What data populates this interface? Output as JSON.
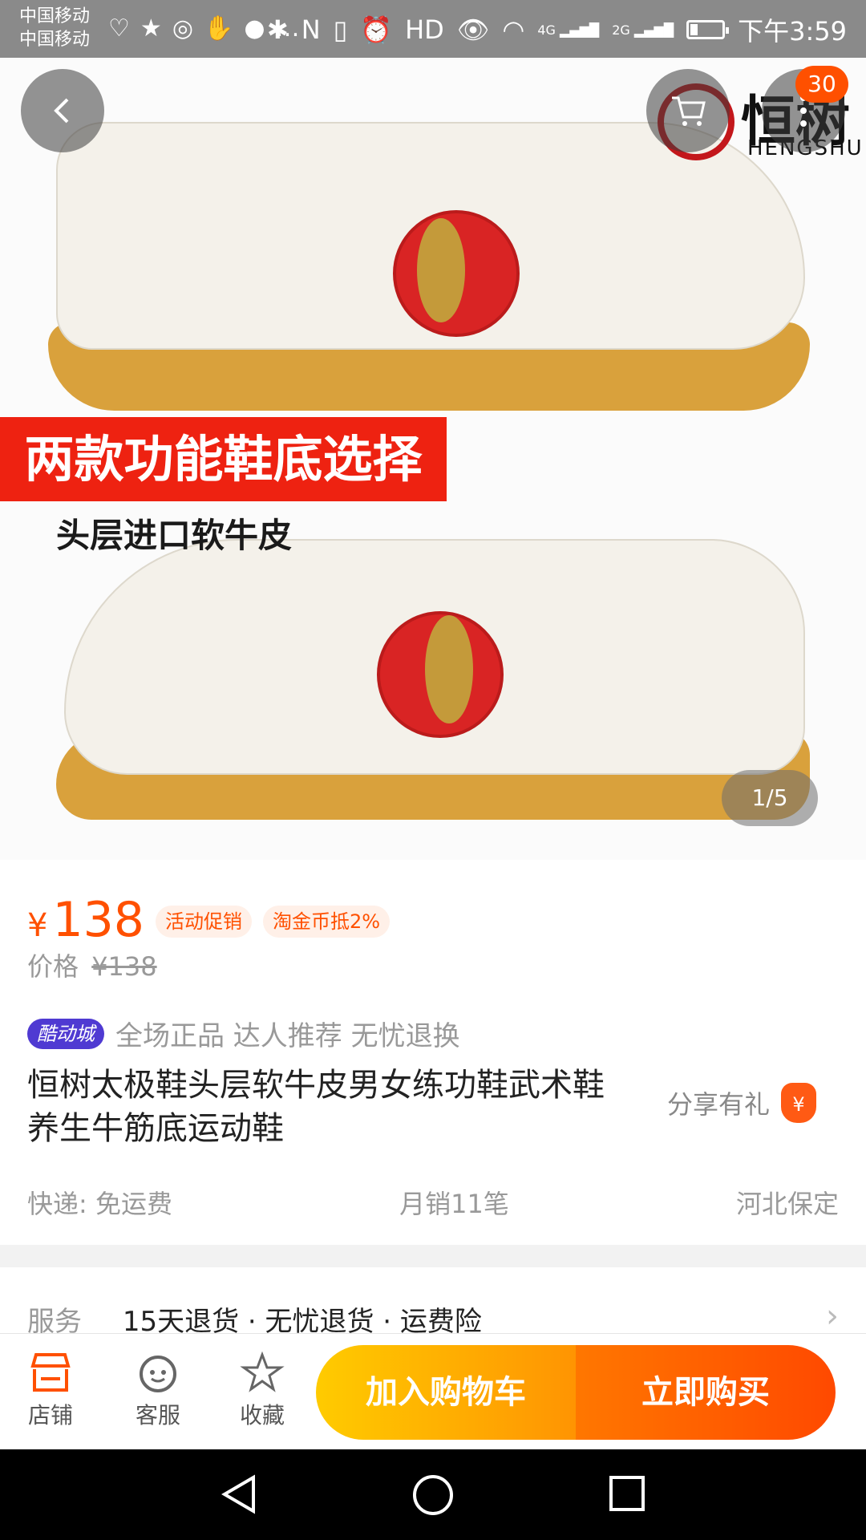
{
  "status_bar": {
    "carrier_1": "中国移动",
    "carrier_2": "中国移动",
    "network_1": "4G",
    "network_2": "2G",
    "hd": "HD",
    "time": "下午3:59",
    "battery_level": 0.22
  },
  "hero": {
    "banner_text": "两款功能鞋底选择",
    "subtitle": "头层进口软牛皮",
    "brand_name": "恒树",
    "brand_latin": "HENGSHU",
    "pager": "1/5",
    "cart_badge": "30"
  },
  "product": {
    "currency": "¥",
    "price": "138",
    "tags": [
      "活动促销",
      "淘金币抵2%"
    ],
    "orig_label": "价格",
    "orig_price": "¥138",
    "kudong_badge": "酷动城",
    "features": "全场正品 达人推荐 无忧退换",
    "title": "恒树太极鞋头层软牛皮男女练功鞋武术鞋养生牛筋底运动鞋",
    "share_label": "分享有礼",
    "share_icon_text": "¥",
    "shipping": "快递: 免运费",
    "monthly_sales": "月销11笔",
    "location": "河北保定"
  },
  "service": {
    "label": "服务",
    "value": "15天退货 · 无忧退货 · 运费险"
  },
  "action_bar": {
    "store": "店铺",
    "support": "客服",
    "favorite": "收藏",
    "add_to_cart": "加入购物车",
    "buy_now": "立即购买"
  },
  "colors": {
    "accent": "#ff5000",
    "cart_button": "#ffb300",
    "buy_button": "#ff5a00",
    "banner": "#ee2211",
    "kudong": "#4f3ad2"
  }
}
